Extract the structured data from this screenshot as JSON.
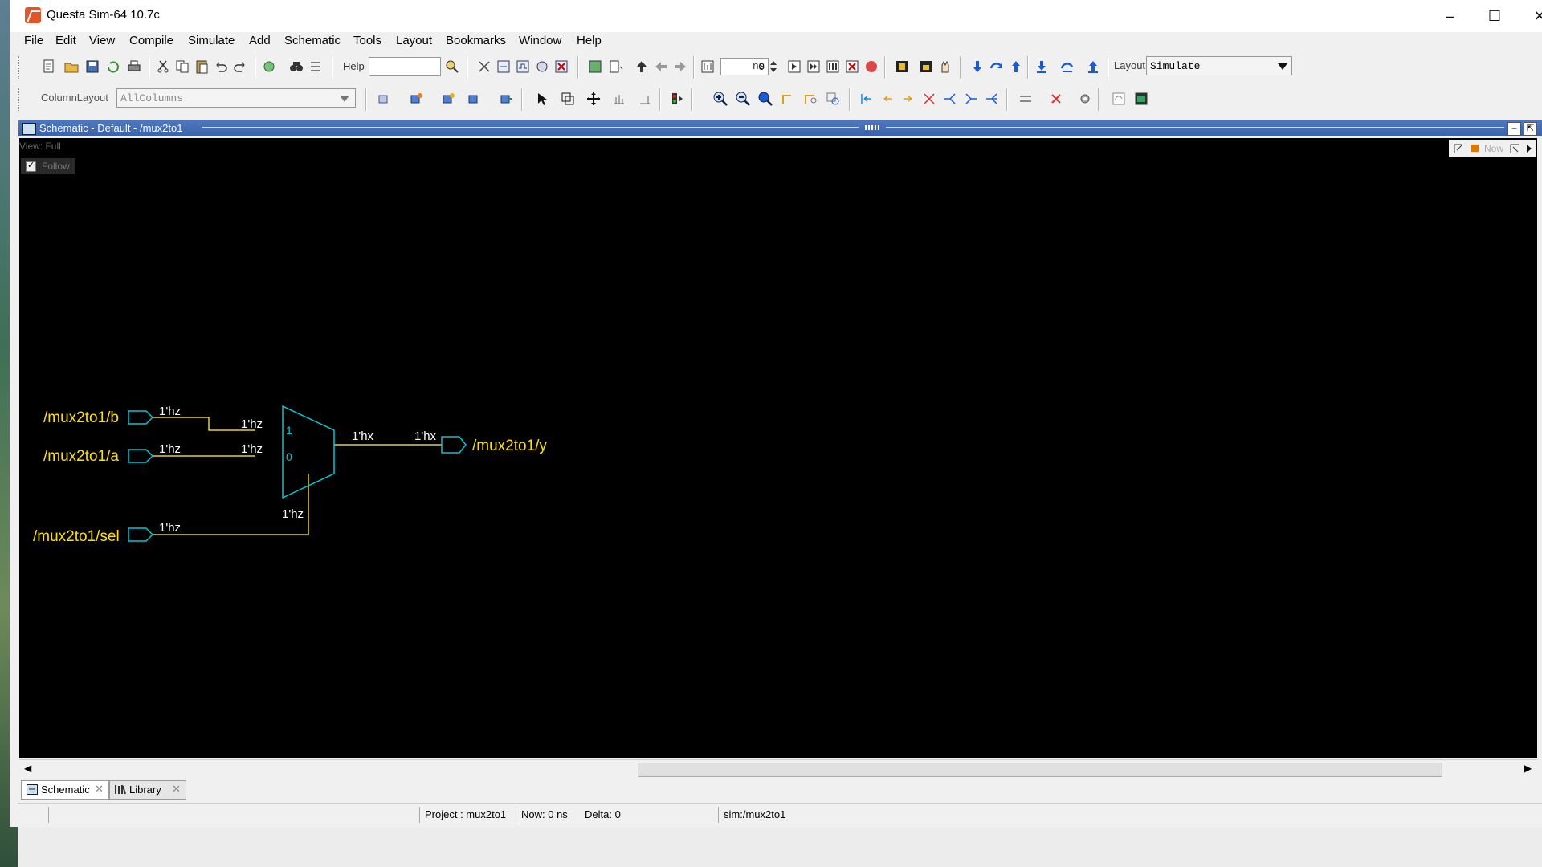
{
  "window": {
    "title": "Questa Sim-64 10.7c"
  },
  "menu": [
    "File",
    "Edit",
    "View",
    "Compile",
    "Simulate",
    "Add",
    "Schematic",
    "Tools",
    "Layout",
    "Bookmarks",
    "Window",
    "Help"
  ],
  "toolbar": {
    "help_label": "Help",
    "help_value": "",
    "time_value": "0",
    "time_unit": "ns",
    "layout_label": "Layout",
    "layout_value": "Simulate",
    "column_layout_label": "ColumnLayout",
    "column_layout_value": "AllColumns"
  },
  "pane": {
    "title": "Schematic - Default - /mux2to1",
    "view_label": "View: Full",
    "follow_label": "Follow",
    "follow_checked": true,
    "now_label": "Now"
  },
  "schematic": {
    "inputs": [
      {
        "name": "/mux2to1/b",
        "value": "1'hz",
        "pin_value": "1'hz",
        "pin": "1"
      },
      {
        "name": "/mux2to1/a",
        "value": "1'hz",
        "pin_value": "1'hz",
        "pin": "0"
      },
      {
        "name": "/mux2to1/sel",
        "value": "1'hz",
        "pin_value": "1'hz"
      }
    ],
    "output": {
      "name": "/mux2to1/y",
      "mux_value": "1'hx",
      "port_value": "1'hx"
    },
    "colors": {
      "wire": "#e6d21f",
      "label": "#ffe000",
      "component": "#00c8d4",
      "background": "#000000"
    }
  },
  "tabs": [
    {
      "label": "Schematic",
      "icon": "schematic-icon",
      "active": true
    },
    {
      "label": "Library",
      "icon": "library-icon",
      "active": false
    }
  ],
  "status": {
    "project": "Project : mux2to1",
    "now": "Now: 0 ns",
    "delta": "Delta: 0",
    "context": "sim:/mux2to1"
  }
}
